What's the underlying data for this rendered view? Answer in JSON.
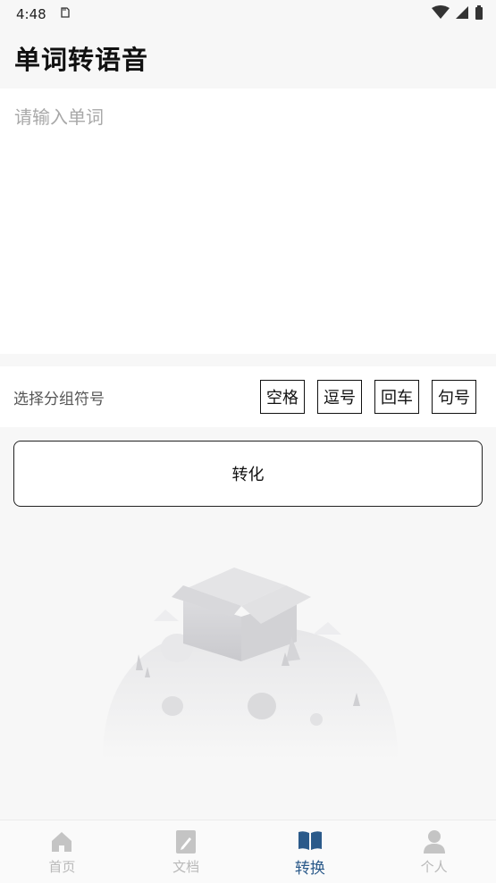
{
  "status_bar": {
    "time": "4:48"
  },
  "header": {
    "title": "单词转语音"
  },
  "input": {
    "placeholder": "请输入单词",
    "value": ""
  },
  "delimiter": {
    "label": "选择分组符号",
    "options": [
      "空格",
      "逗号",
      "回车",
      "句号"
    ]
  },
  "convert_button": {
    "label": "转化"
  },
  "bottom_nav": {
    "items": [
      {
        "label": "首页",
        "icon": "home-icon",
        "active": false
      },
      {
        "label": "文档",
        "icon": "document-icon",
        "active": false
      },
      {
        "label": "转换",
        "icon": "book-icon",
        "active": true
      },
      {
        "label": "个人",
        "icon": "person-icon",
        "active": false
      }
    ]
  },
  "colors": {
    "active": "#2b5a8a",
    "inactive": "#b9b9b9",
    "background": "#f7f7f7"
  }
}
